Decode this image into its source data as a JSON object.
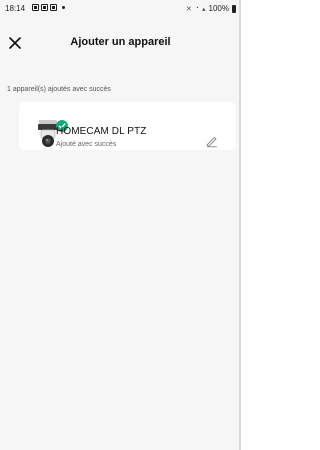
{
  "status_bar": {
    "time": "18:14",
    "battery_text": "100%"
  },
  "header": {
    "title": "Ajouter un appareil"
  },
  "summary": {
    "text": "1 appareil(s) ajoutés avec succès"
  },
  "devices": [
    {
      "name": "HOMECAM DL PTZ",
      "status": "Ajouté avec succès",
      "status_color": "#1aa57a"
    }
  ],
  "icons": {
    "close": "close-icon",
    "device": "camera-icon",
    "badge": "check-icon",
    "edit": "edit-icon"
  }
}
